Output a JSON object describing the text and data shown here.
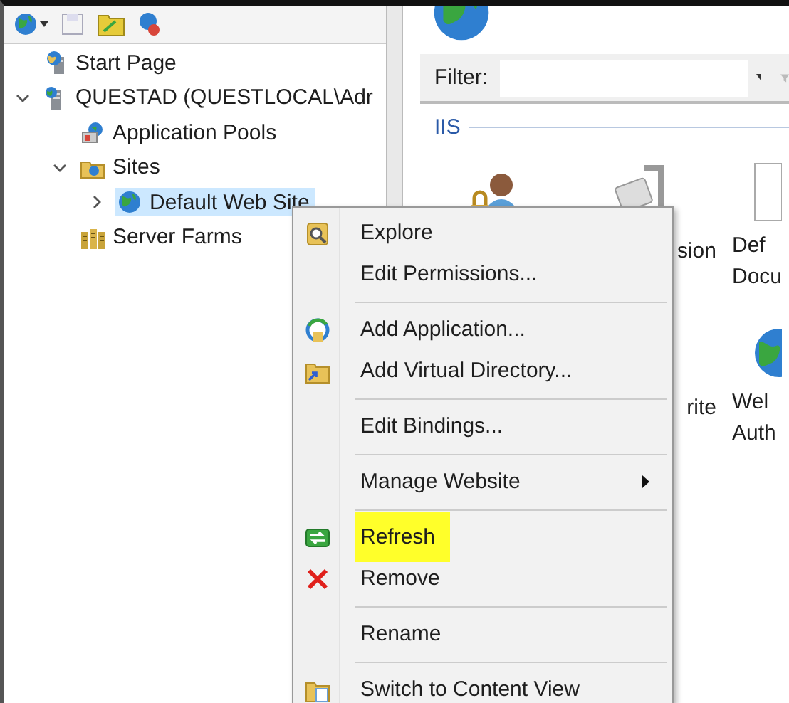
{
  "tree": [
    {
      "kind": "start-page",
      "label": "Start Page",
      "selected": false
    },
    {
      "kind": "server",
      "label": "QUESTAD (QUESTLOCAL\\Adr",
      "expanded": true,
      "selected": false,
      "children": [
        {
          "kind": "app-pools",
          "label": "Application Pools",
          "selected": false
        },
        {
          "kind": "sites",
          "label": "Sites",
          "expanded": true,
          "selected": false,
          "children": [
            {
              "kind": "site",
              "label": "Default Web Site",
              "expanded": false,
              "selected": true
            }
          ]
        },
        {
          "kind": "server-farms",
          "label": "Server Farms",
          "selected": false
        }
      ]
    }
  ],
  "filter": {
    "label": "Filter:"
  },
  "group": {
    "title": "IIS"
  },
  "features": [
    {
      "kind": "user-lock"
    },
    {
      "kind": "clamp",
      "label_lines": [
        "sion"
      ]
    },
    {
      "kind": "document",
      "label_lines": [
        "Def",
        "Docu"
      ]
    },
    {
      "kind": "blank"
    },
    {
      "kind": "blank",
      "label_lines": [
        "rite"
      ]
    },
    {
      "kind": "globe",
      "label_lines": [
        "Wel",
        "Auth"
      ]
    }
  ],
  "context_menu": {
    "items": [
      {
        "kind": "item",
        "label": "Explore",
        "submenu": false,
        "highlighted": false
      },
      {
        "kind": "item",
        "label": "Edit Permissions...",
        "submenu": false,
        "highlighted": false
      },
      {
        "kind": "separator"
      },
      {
        "kind": "item",
        "label": "Add Application...",
        "submenu": false,
        "highlighted": false
      },
      {
        "kind": "item",
        "label": "Add Virtual Directory...",
        "submenu": false,
        "highlighted": false
      },
      {
        "kind": "separator"
      },
      {
        "kind": "item",
        "label": "Edit Bindings...",
        "submenu": false,
        "highlighted": false
      },
      {
        "kind": "separator"
      },
      {
        "kind": "item",
        "label": "Manage Website",
        "submenu": true,
        "highlighted": false
      },
      {
        "kind": "separator"
      },
      {
        "kind": "item",
        "label": "Refresh",
        "submenu": false,
        "highlighted": true
      },
      {
        "kind": "item",
        "label": "Remove",
        "submenu": false,
        "highlighted": false
      },
      {
        "kind": "separator"
      },
      {
        "kind": "item",
        "label": "Rename",
        "submenu": false,
        "highlighted": false
      },
      {
        "kind": "separator"
      },
      {
        "kind": "item",
        "label": "Switch to Content View",
        "submenu": false,
        "highlighted": false
      }
    ]
  }
}
